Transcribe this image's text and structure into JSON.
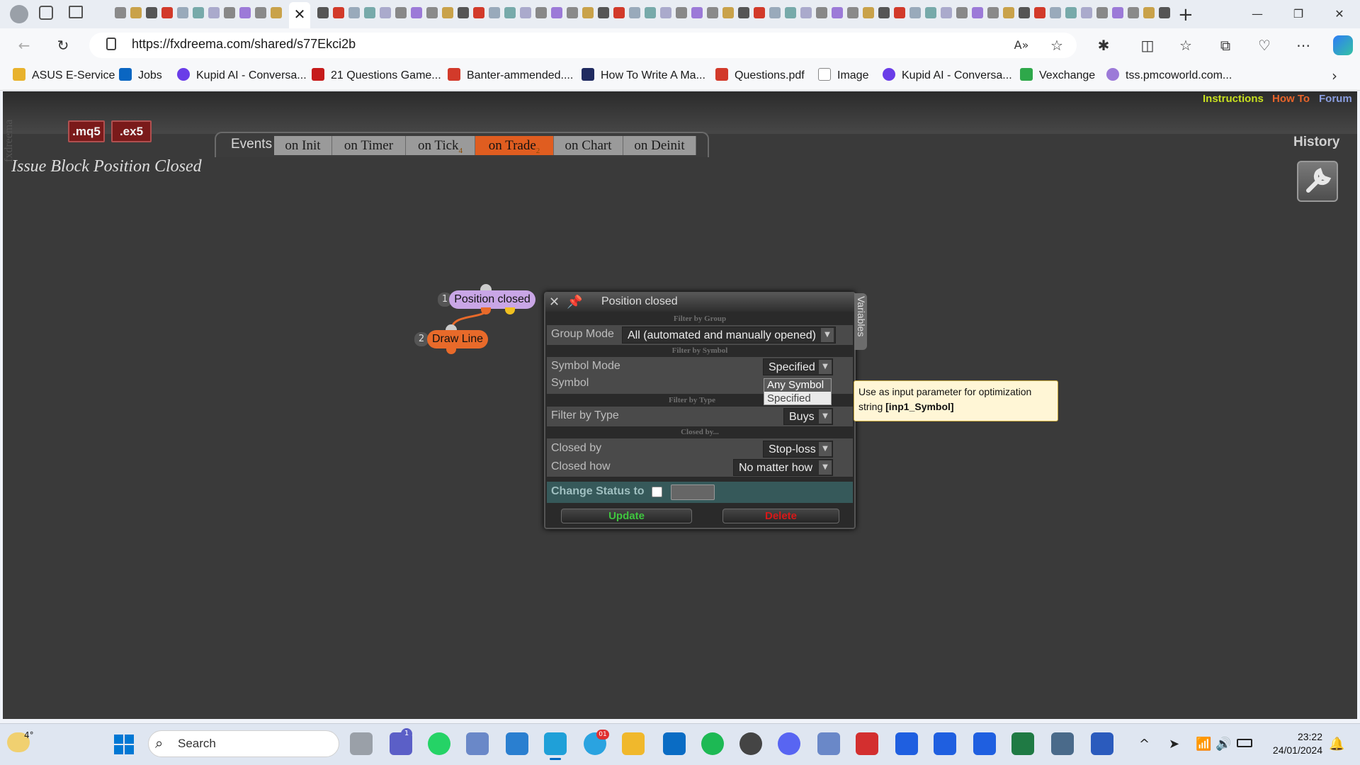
{
  "browser": {
    "url": "https://fxdreema.com/shared/s77Ekci2b",
    "active_tab_close": "✕",
    "new_tab": "+",
    "window_controls": {
      "minimize": "—",
      "restore": "❐",
      "close": "✕"
    }
  },
  "bookmarks": [
    {
      "label": "ASUS E-Service",
      "icon_color": "#e8b22c"
    },
    {
      "label": "Jobs",
      "icon_color": "#0a66c2"
    },
    {
      "label": "Kupid AI - Conversa...",
      "icon_color": "#6a3de8"
    },
    {
      "label": "21 Questions Game...",
      "icon_color": "#c61b1b"
    },
    {
      "label": "Banter-ammended....",
      "icon_color": "#d23a2a"
    },
    {
      "label": "How To Write A Ma...",
      "icon_color": "#1f2a60"
    },
    {
      "label": "Questions.pdf",
      "icon_color": "#d23a2a"
    },
    {
      "label": "Image",
      "icon_color": "#888888"
    },
    {
      "label": "Kupid AI - Conversa...",
      "icon_color": "#6a3de8"
    },
    {
      "label": "Vexchange",
      "icon_color": "#2ea84a"
    },
    {
      "label": "tss.pmcoworld.com...",
      "icon_color": "#9c7ad8"
    }
  ],
  "app": {
    "brand": "fxdreema",
    "file_buttons": [
      ".mq5",
      ".ex5"
    ],
    "top_links": [
      {
        "label": "Instructions",
        "color": "#c8e020"
      },
      {
        "label": "How To",
        "color": "#e8642a"
      },
      {
        "label": "Forum",
        "color": "#8a9ee0"
      }
    ],
    "history": "History",
    "events_label": "Events",
    "event_tabs": [
      {
        "label": "on Init",
        "count": "",
        "active": false
      },
      {
        "label": "on Timer",
        "count": "",
        "active": false
      },
      {
        "label": "on Tick",
        "count": "4",
        "active": false
      },
      {
        "label": "on Trade",
        "count": "2",
        "active": true
      },
      {
        "label": "on Chart",
        "count": "",
        "active": false
      },
      {
        "label": "on Deinit",
        "count": "",
        "active": false
      }
    ],
    "page_title": "Issue Block Position Closed",
    "blocks": [
      {
        "num": "1",
        "label": "Position closed"
      },
      {
        "num": "2",
        "label": "Draw Line"
      }
    ]
  },
  "panel": {
    "title": "Position closed",
    "variables_tab": "Variables",
    "sections": {
      "group": "Filter by Group",
      "symbol": "Filter by Symbol",
      "type": "Filter by Type",
      "closed": "Closed by..."
    },
    "fields": {
      "group_mode": {
        "label": "Group Mode",
        "value": "All (automated and manually opened)"
      },
      "symbol_mode": {
        "label": "Symbol Mode",
        "value": "Specified"
      },
      "symbol": {
        "label": "Symbol"
      },
      "filter_type": {
        "label": "Filter by Type",
        "value": "Buys"
      },
      "closed_by": {
        "label": "Closed by",
        "value": "Stop-loss"
      },
      "closed_how": {
        "label": "Closed how",
        "value": "No matter how"
      }
    },
    "dropdown_options": [
      "Any Symbol",
      "Specified"
    ],
    "tooltip": {
      "line1": "Use as input parameter for optimization",
      "line2_prefix": "string ",
      "line2_code": "[inp1_Symbol]"
    },
    "change_status_label": "Change Status to",
    "change_status_checked": false,
    "update_label": "Update",
    "delete_label": "Delete"
  },
  "taskbar": {
    "weather_temp": "4°",
    "search_placeholder": "Search",
    "time": "23:22",
    "date": "24/01/2024",
    "chat_badge": "1",
    "telegram_badge": "01"
  }
}
